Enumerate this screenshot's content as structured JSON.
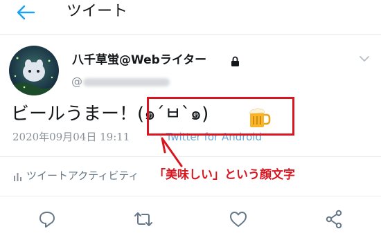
{
  "header": {
    "title": "ツイート",
    "back_icon": "arrow-left-icon"
  },
  "tweet": {
    "display_name": "八千草蛍@Webライター",
    "handle_visible": "@",
    "protected_icon": "lock-icon",
    "text": "ビールうまー！(๑´ㅂ`๑)",
    "emoji": "beer-mug",
    "timestamp": "2020年09月04日 19:11",
    "via": "· Twitter for Android",
    "activity_label": "ツイートアクティビティ"
  },
  "annotation": {
    "label": "「美味しい」という顔文字",
    "color": "#d9161f"
  },
  "actions": [
    {
      "icon": "reply-icon"
    },
    {
      "icon": "retweet-icon"
    },
    {
      "icon": "like-icon"
    },
    {
      "icon": "share-icon"
    }
  ],
  "colors": {
    "accent": "#1da1f2",
    "muted": "#8a9199",
    "link": "#6aa7d6"
  }
}
